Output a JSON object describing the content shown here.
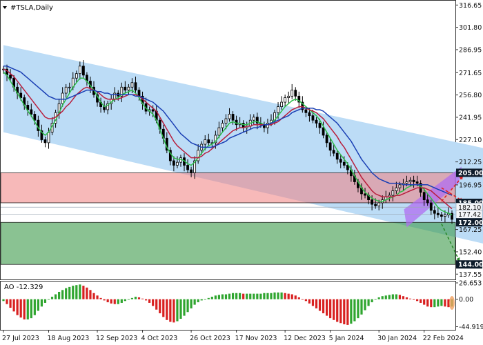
{
  "chart_data": {
    "type": "candlestick",
    "title": "#TSLA,Daily",
    "y_ticks": [
      "316.65",
      "301.80",
      "286.95",
      "271.65",
      "256.80",
      "241.95",
      "227.10",
      "212.25",
      "196.95",
      "167.25",
      "152.40",
      "137.55"
    ],
    "price_tags": [
      {
        "value": 205.0,
        "label": "205.00",
        "style": "dark"
      },
      {
        "value": 185.0,
        "label": "185.00",
        "style": "dark"
      },
      {
        "value": 182.1,
        "label": "182.10",
        "style": "light"
      },
      {
        "value": 177.42,
        "label": "177.42",
        "style": "light"
      },
      {
        "value": 172.0,
        "label": "172.00",
        "style": "dark"
      },
      {
        "value": 144.0,
        "label": "144.00",
        "style": "dark"
      }
    ],
    "x_labels": [
      "27 Jul 2023",
      "18 Aug 2023",
      "12 Sep 2023",
      "4 Oct 2023",
      "26 Oct 2023",
      "17 Nov 2023",
      "12 Dec 2023",
      "5 Jan 2024",
      "30 Jan 2024",
      "22 Feb 2024"
    ],
    "channel": {
      "upper": [
        [
          0,
          290
        ],
        [
          145,
          216
        ]
      ],
      "lower": [
        [
          0,
          232
        ],
        [
          145,
          152
        ]
      ]
    },
    "resistance_zone": [
      185,
      205
    ],
    "support_zone": [
      144,
      172
    ],
    "current_box": {
      "from": [
        116,
        177
      ],
      "to": [
        131,
        200
      ]
    },
    "series": [
      {
        "name": "close",
        "color": "#000000",
        "values": [
          274,
          270,
          268,
          262,
          258,
          255,
          250,
          247,
          244,
          240,
          233,
          227,
          225,
          232,
          238,
          245,
          251,
          258,
          262,
          262,
          268,
          271,
          276,
          270,
          266,
          262,
          257,
          252,
          249,
          247,
          251,
          254,
          258,
          256,
          262,
          260,
          262,
          265,
          260,
          256,
          251,
          246,
          247,
          246,
          240,
          234,
          228,
          220,
          213,
          210,
          212,
          215,
          210,
          207,
          205,
          213,
          220,
          224,
          227,
          225,
          225,
          230,
          235,
          238,
          241,
          244,
          240,
          237,
          238,
          235,
          236,
          240,
          242,
          238,
          237,
          235,
          238,
          240,
          245,
          249,
          252,
          255,
          256,
          260,
          256,
          252,
          247,
          245,
          243,
          240,
          238,
          235,
          230,
          225,
          220,
          218,
          214,
          212,
          210,
          207,
          203,
          199,
          195,
          191,
          190,
          187,
          184,
          183,
          185,
          187,
          189,
          190,
          193,
          195,
          197,
          198,
          199,
          200,
          199,
          198,
          192,
          187,
          185,
          180,
          178,
          177,
          176,
          177,
          178,
          174
        ]
      },
      {
        "name": "ma-fast",
        "color": "#2ebd4a",
        "values": [
          272,
          270,
          266,
          262,
          258,
          254,
          250,
          246,
          243,
          239,
          235,
          232,
          230,
          232,
          236,
          240,
          245,
          250,
          254,
          258,
          262,
          265,
          268,
          268,
          266,
          263,
          260,
          256,
          252,
          249,
          250,
          252,
          254,
          255,
          257,
          258,
          259,
          260,
          258,
          255,
          251,
          248,
          246,
          244,
          240,
          234,
          228,
          222,
          218,
          215,
          214,
          214,
          213,
          211,
          210,
          212,
          215,
          218,
          221,
          223,
          224,
          226,
          229,
          232,
          235,
          238,
          239,
          238,
          238,
          237,
          237,
          238,
          239,
          239,
          238,
          237,
          237,
          238,
          240,
          243,
          246,
          249,
          251,
          253,
          254,
          253,
          251,
          249,
          247,
          245,
          243,
          240,
          236,
          232,
          228,
          224,
          220,
          217,
          214,
          211,
          207,
          203,
          199,
          195,
          192,
          190,
          188,
          187,
          186,
          186,
          187,
          188,
          189,
          190,
          192,
          193,
          195,
          196,
          197,
          197,
          196,
          194,
          191,
          188,
          185,
          182,
          180,
          179,
          178,
          177
        ]
      },
      {
        "name": "ma-mid",
        "color": "#b81e3c",
        "values": [
          274,
          273,
          271,
          269,
          266,
          263,
          260,
          257,
          254,
          251,
          248,
          245,
          242,
          241,
          241,
          242,
          244,
          246,
          249,
          251,
          254,
          257,
          259,
          261,
          262,
          261,
          260,
          259,
          257,
          255,
          254,
          254,
          254,
          254,
          255,
          256,
          257,
          257,
          257,
          256,
          254,
          252,
          250,
          248,
          246,
          242,
          238,
          234,
          230,
          226,
          223,
          221,
          219,
          217,
          215,
          215,
          215,
          216,
          218,
          219,
          221,
          223,
          225,
          227,
          229,
          231,
          233,
          234,
          235,
          235,
          236,
          236,
          237,
          237,
          237,
          237,
          237,
          237,
          238,
          239,
          241,
          243,
          245,
          247,
          248,
          249,
          249,
          248,
          247,
          246,
          245,
          243,
          241,
          238,
          235,
          232,
          229,
          225,
          222,
          218,
          214,
          210,
          206,
          202,
          199,
          196,
          193,
          191,
          190,
          189,
          189,
          189,
          189,
          190,
          190,
          191,
          192,
          193,
          194,
          195,
          195,
          195,
          194,
          193,
          191,
          189,
          187,
          185,
          183,
          181
        ]
      },
      {
        "name": "ma-slow",
        "color": "#1a3fb4",
        "values": [
          276,
          276,
          275,
          274,
          273,
          272,
          270,
          268,
          266,
          264,
          262,
          260,
          258,
          256,
          255,
          254,
          254,
          254,
          254,
          255,
          256,
          257,
          258,
          259,
          260,
          260,
          260,
          259,
          259,
          258,
          258,
          257,
          257,
          257,
          257,
          257,
          257,
          257,
          256,
          256,
          255,
          254,
          253,
          252,
          250,
          248,
          246,
          243,
          240,
          237,
          234,
          231,
          229,
          227,
          225,
          224,
          223,
          222,
          222,
          222,
          222,
          223,
          224,
          225,
          226,
          228,
          229,
          230,
          231,
          232,
          233,
          234,
          235,
          235,
          236,
          237,
          237,
          238,
          239,
          240,
          241,
          242,
          243,
          245,
          246,
          247,
          248,
          248,
          248,
          248,
          247,
          247,
          246,
          244,
          242,
          240,
          238,
          235,
          232,
          229,
          226,
          222,
          218,
          214,
          211,
          208,
          205,
          203,
          201,
          200,
          199,
          198,
          198,
          198,
          198,
          197,
          197,
          197,
          197,
          197,
          197,
          197,
          197,
          196,
          195,
          194,
          193,
          192,
          191,
          190
        ]
      }
    ],
    "ylim": [
      134,
      320
    ],
    "indicator": {
      "name": "AO",
      "label": "AO -12.329",
      "ticks": [
        "26.653",
        "0.00",
        "-44.919"
      ],
      "ylim": [
        -50,
        30
      ],
      "values": [
        -3,
        -8,
        -14,
        -20,
        -26,
        -30,
        -33,
        -33,
        -31,
        -26,
        -19,
        -12,
        -6,
        0,
        4,
        8,
        12,
        15,
        18,
        20,
        22,
        23,
        24,
        22,
        19,
        15,
        10,
        6,
        2,
        -2,
        -5,
        -7,
        -8,
        -8,
        -6,
        -3,
        0,
        2,
        4,
        3,
        1,
        -2,
        -6,
        -11,
        -17,
        -23,
        -29,
        -34,
        -37,
        -38,
        -36,
        -32,
        -27,
        -21,
        -15,
        -9,
        -5,
        -2,
        0,
        2,
        4,
        6,
        7,
        8,
        8,
        9,
        10,
        10,
        10,
        9,
        9,
        9,
        9,
        9,
        9,
        10,
        10,
        10,
        11,
        11,
        11,
        10,
        9,
        8,
        6,
        3,
        0,
        -3,
        -7,
        -11,
        -15,
        -19,
        -23,
        -27,
        -31,
        -34,
        -37,
        -39,
        -41,
        -42,
        -40,
        -36,
        -31,
        -25,
        -18,
        -11,
        -5,
        0,
        3,
        5,
        6,
        7,
        8,
        8,
        7,
        5,
        3,
        1,
        -1,
        -3,
        -6,
        -9,
        -12,
        -13,
        -13,
        -12,
        -11,
        -12,
        -13,
        -12
      ]
    },
    "arrows": [
      {
        "color": "#e02020",
        "style": "dashed",
        "from": [
          126,
          186
        ],
        "to": [
          131,
          203
        ]
      },
      {
        "color": "#e02020",
        "style": "dashed",
        "from": [
          126,
          195
        ],
        "to": [
          131,
          186
        ]
      },
      {
        "color": "#2a8a2a",
        "style": "dashed",
        "from": [
          126,
          171
        ],
        "to": [
          130,
          146
        ]
      }
    ]
  }
}
